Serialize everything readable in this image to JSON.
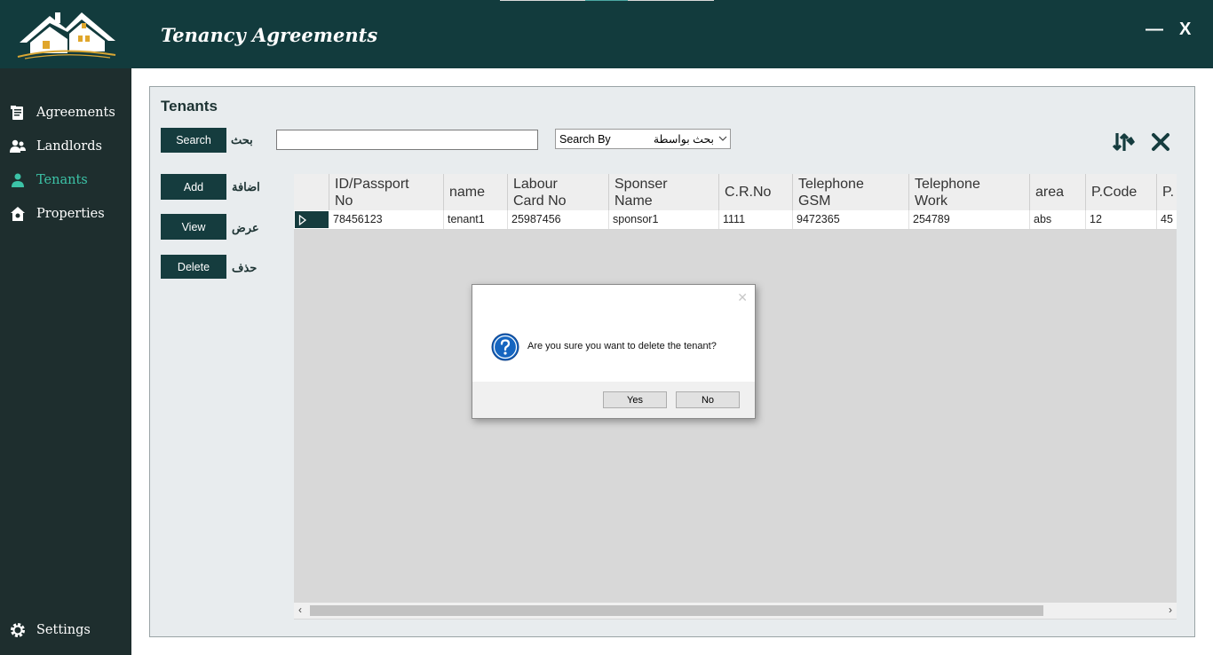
{
  "window": {
    "title": "Tenancy Agreements",
    "minimize_label": "—",
    "close_label": "X"
  },
  "sidebar": {
    "items": [
      {
        "label": "Agreements",
        "icon": "agreements-icon"
      },
      {
        "label": "Landlords",
        "icon": "landlords-icon"
      },
      {
        "label": "Tenants",
        "icon": "tenant-icon",
        "active": true
      },
      {
        "label": "Properties",
        "icon": "properties-icon"
      }
    ],
    "settings_label": "Settings"
  },
  "colors": {
    "topbar": "#123b3d",
    "sidebar": "#1e2e2e",
    "accent": "#3cc3a7",
    "button_dark": "#153c3e"
  },
  "panel": {
    "title": "Tenants",
    "search_button": "Search",
    "search_ar": "بحث",
    "search_value": "",
    "search_by": {
      "label_en": "Search By",
      "label_ar": "بحث بواسطة"
    },
    "add_button": "Add",
    "add_ar": "اضافة",
    "view_button": "View",
    "view_ar": "عرض",
    "delete_button": "Delete",
    "delete_ar": "حذف"
  },
  "grid": {
    "columns": [
      {
        "line1": "ID/Passport",
        "line2": "No"
      },
      {
        "line1": "name",
        "line2": ""
      },
      {
        "line1": "Labour",
        "line2": "Card No"
      },
      {
        "line1": "Sponser",
        "line2": "Name"
      },
      {
        "line1": "C.R.No",
        "line2": ""
      },
      {
        "line1": "Telephone",
        "line2": "GSM"
      },
      {
        "line1": "Telephone",
        "line2": "Work"
      },
      {
        "line1": "area",
        "line2": ""
      },
      {
        "line1": "P.Code",
        "line2": ""
      },
      {
        "line1": "P.",
        "line2": ""
      }
    ],
    "rows": [
      [
        "78456123",
        "tenant1",
        "25987456",
        "sponsor1",
        "1111",
        "9472365",
        "254789",
        "abs",
        "12",
        "45"
      ]
    ]
  },
  "dialog": {
    "message": "Are you sure you want to delete the tenant?",
    "yes": "Yes",
    "no": "No",
    "icon": "question-icon"
  }
}
